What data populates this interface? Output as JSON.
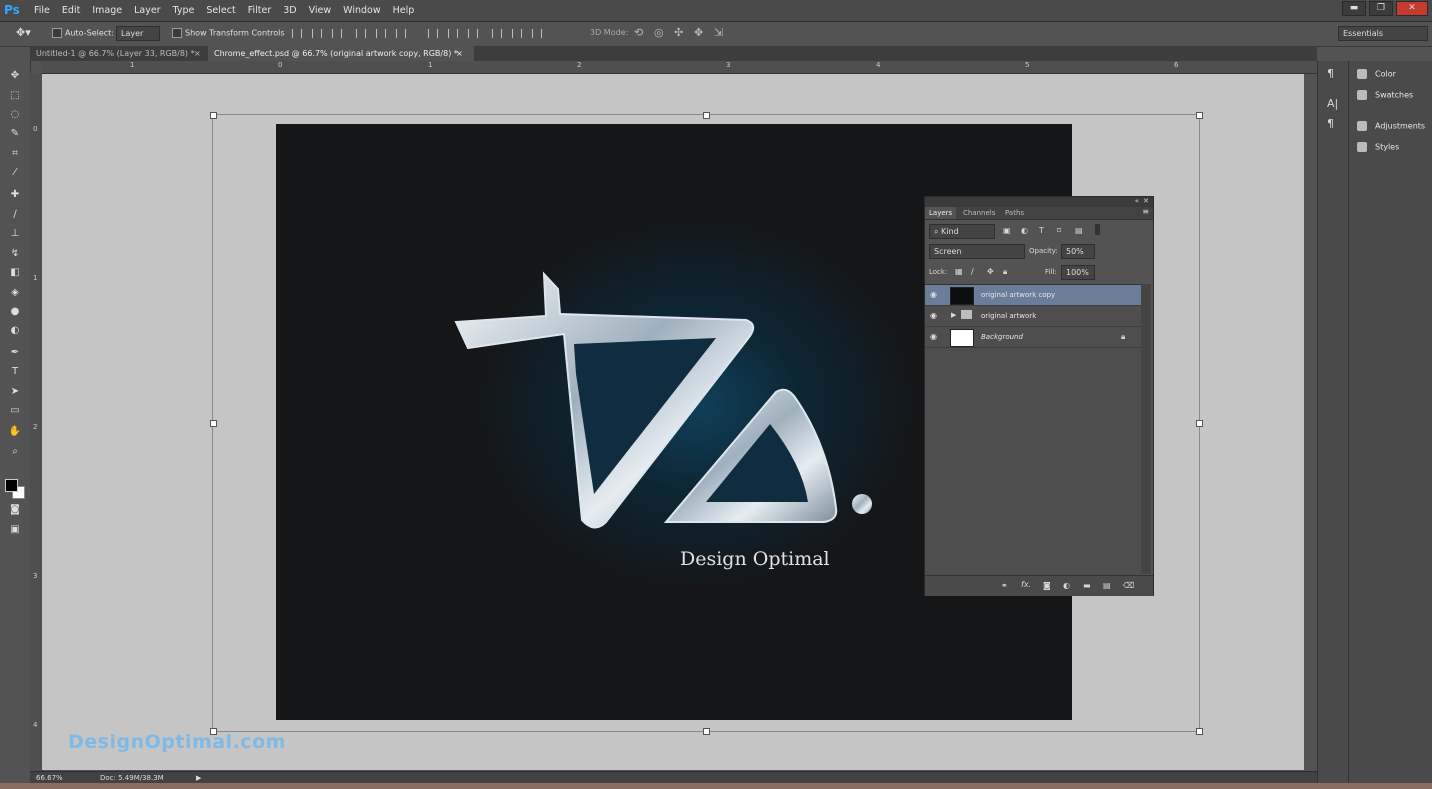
{
  "app": {
    "logo": "Ps"
  },
  "menu": [
    "File",
    "Edit",
    "Image",
    "Layer",
    "Type",
    "Select",
    "Filter",
    "3D",
    "View",
    "Window",
    "Help"
  ],
  "window_controls": {
    "minimize": "▬",
    "restore": "❐",
    "close": "✕"
  },
  "options": {
    "auto_select_label": "Auto-Select:",
    "auto_select_value": "Layer",
    "show_transform_label": "Show Transform Controls",
    "mode3d_label": "3D Mode:",
    "workspace": "Essentials"
  },
  "tabs": [
    {
      "label": "Untitled-1 @ 66.7% (Layer 33, RGB/8) *",
      "close": "×"
    },
    {
      "label": "Chrome_effect.psd @ 66.7% (original artwork copy, RGB/8) *",
      "close": "×"
    }
  ],
  "rulers": {
    "top": [
      "1",
      "0",
      "1",
      "2",
      "3",
      "4",
      "5",
      "6"
    ],
    "left": [
      "0",
      "1",
      "2",
      "3",
      "4"
    ]
  },
  "artwork": {
    "wordmark": "Design Optimal"
  },
  "watermark": "DesignOptimal.com",
  "status": {
    "zoom": "66.67%",
    "doc": "Doc: 5.49M/38.3M",
    "arrow": "▶"
  },
  "dock": [
    {
      "label": "Color",
      "icon": "color-icon"
    },
    {
      "label": "Swatches",
      "icon": "swatches-icon"
    },
    {
      "label": "Adjustments",
      "icon": "adjustments-icon"
    },
    {
      "label": "Styles",
      "icon": "styles-icon"
    }
  ],
  "dock_icons": [
    "¶",
    "A|",
    "¶"
  ],
  "layers_panel": {
    "tabs": [
      "Layers",
      "Channels",
      "Paths"
    ],
    "kind_label": "Kind",
    "blend_mode": "Screen",
    "opacity_label": "Opacity:",
    "opacity_value": "50%",
    "lock_label": "Lock:",
    "fill_label": "Fill:",
    "fill_value": "100%",
    "layers": [
      {
        "name": "original artwork copy",
        "selected": true
      },
      {
        "name": "original artwork",
        "selected": false
      },
      {
        "name": "Background",
        "selected": false
      }
    ],
    "footer_fx": "fx."
  }
}
